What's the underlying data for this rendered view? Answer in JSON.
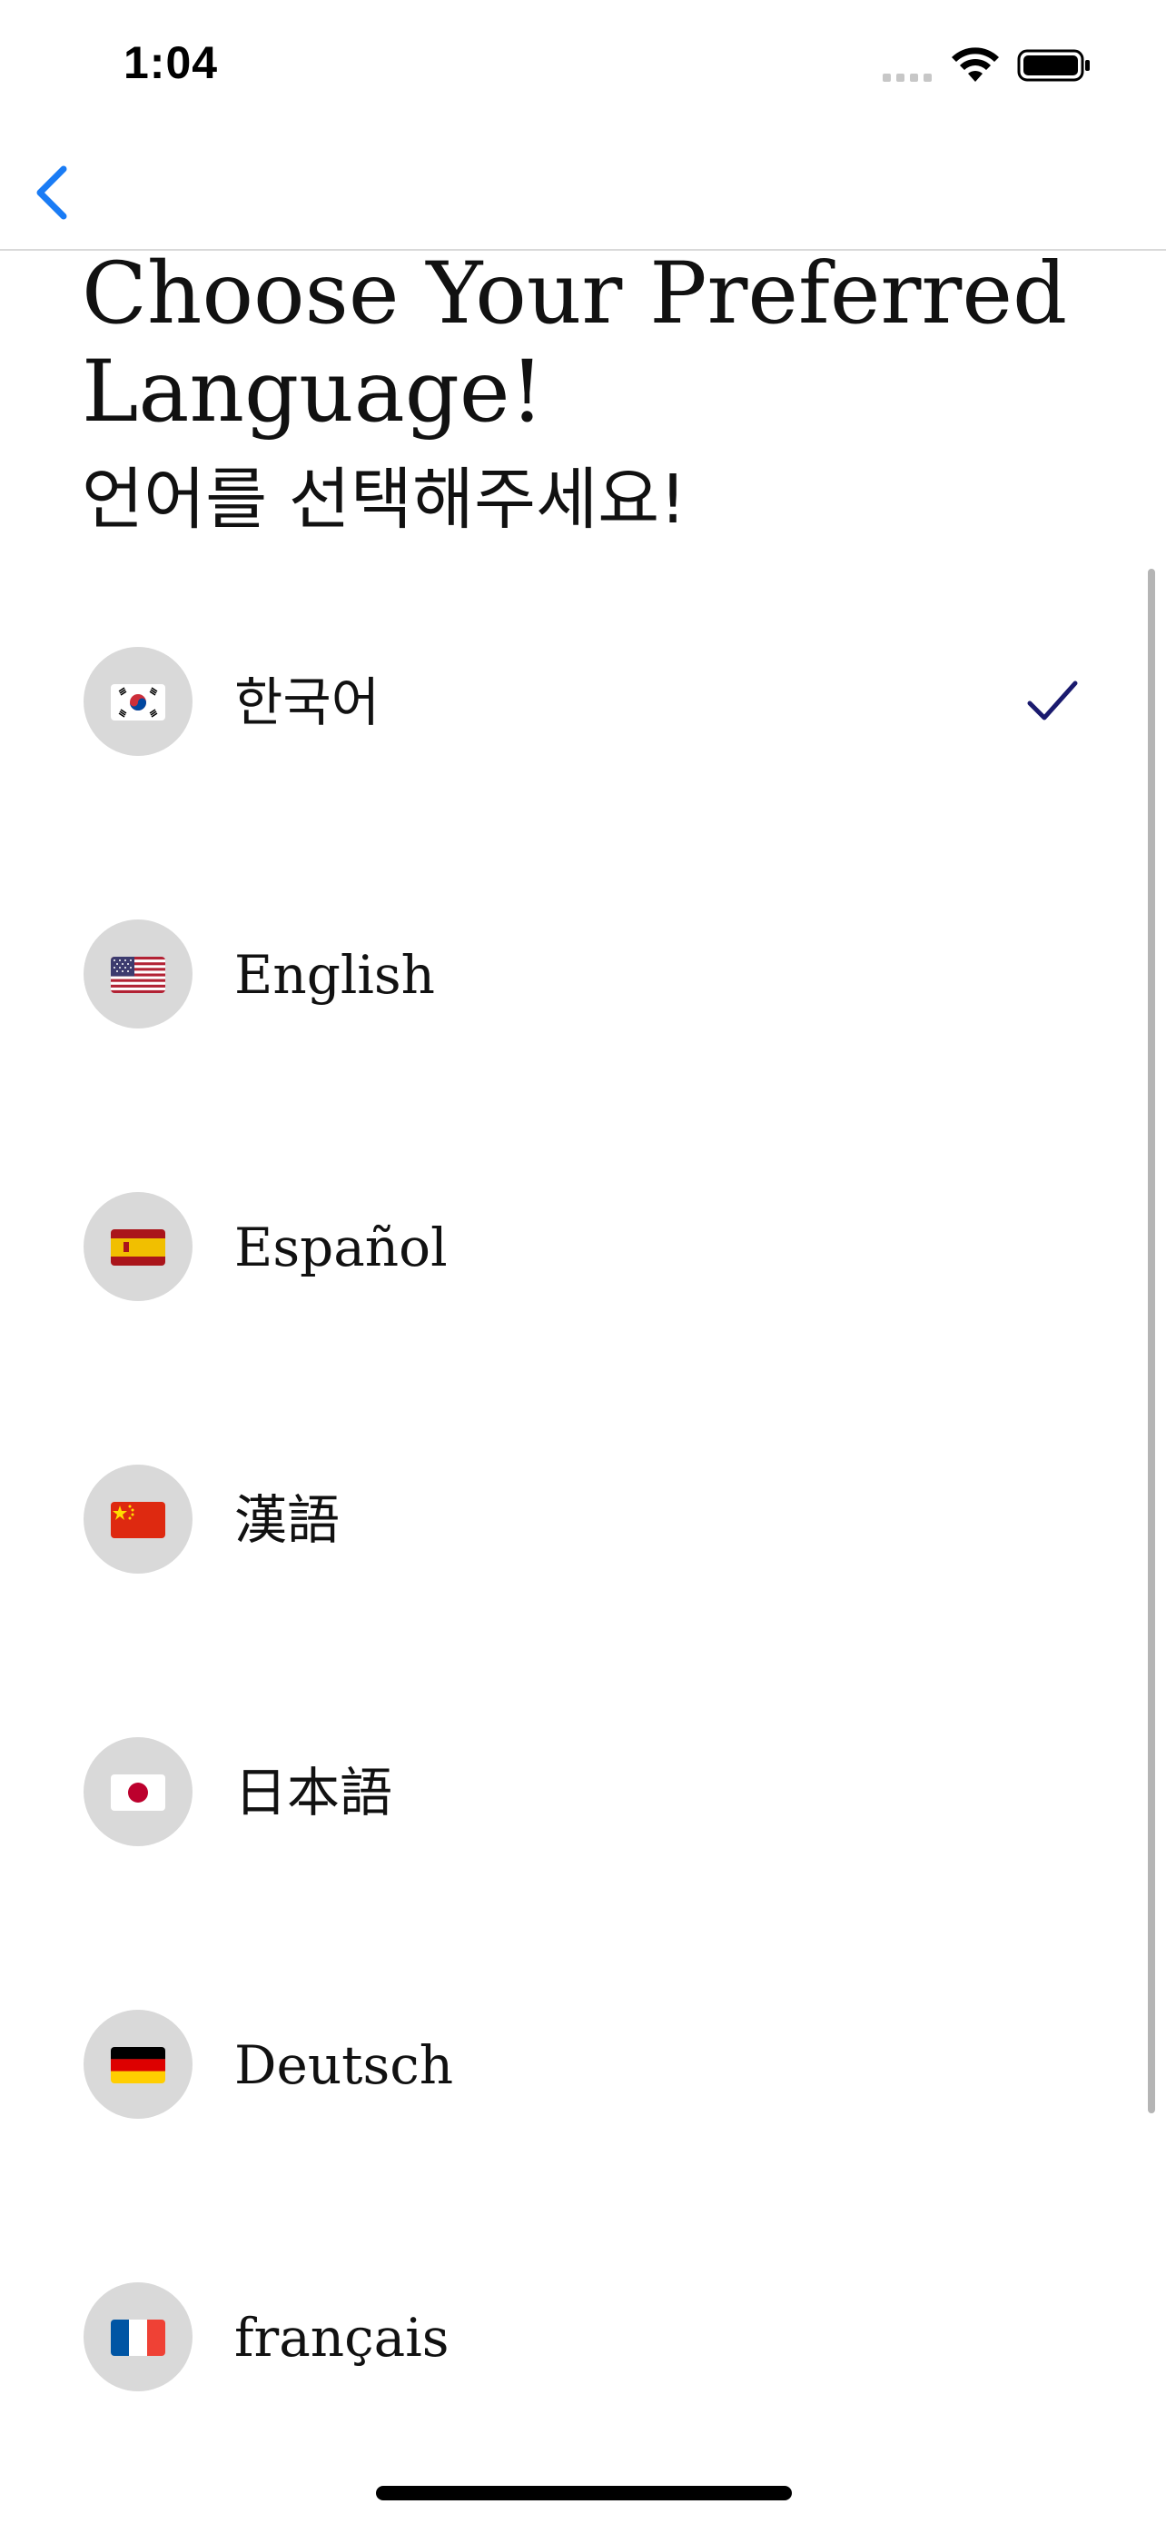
{
  "status_bar": {
    "time": "1:04",
    "icons": [
      "signal-dots-icon",
      "wifi-icon",
      "battery-icon"
    ]
  },
  "nav": {
    "back_icon": "chevron-left-icon"
  },
  "header": {
    "title": "Choose Your Preferred Language!",
    "subtitle": "언어를 선택해주세요!"
  },
  "languages": [
    {
      "label": "한국어",
      "flag_icon": "flag-kr-icon",
      "selected": true
    },
    {
      "label": "English",
      "flag_icon": "flag-us-icon",
      "selected": false
    },
    {
      "label": "Español",
      "flag_icon": "flag-es-icon",
      "selected": false
    },
    {
      "label": "漢語",
      "flag_icon": "flag-cn-icon",
      "selected": false
    },
    {
      "label": "日本語",
      "flag_icon": "flag-jp-icon",
      "selected": false
    },
    {
      "label": "Deutsch",
      "flag_icon": "flag-de-icon",
      "selected": false
    },
    {
      "label": "français",
      "flag_icon": "flag-fr-icon",
      "selected": false
    }
  ],
  "colors": {
    "accent_blue": "#1a7cf5",
    "check_navy": "#1a1a6e",
    "flag_bg": "#d9d9d9",
    "divider": "#d9d9d9"
  }
}
